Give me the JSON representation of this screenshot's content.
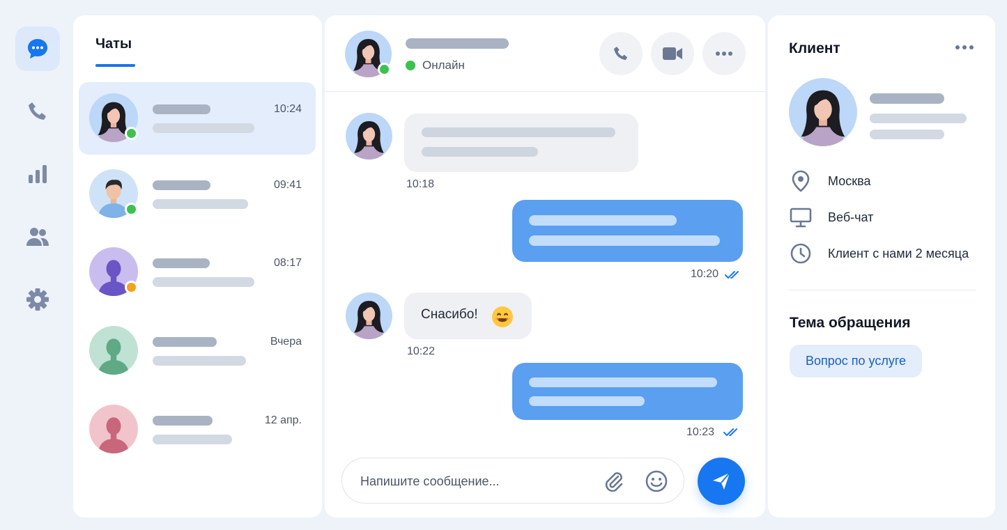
{
  "nav": {
    "items": [
      {
        "icon": "chat-bubble-icon",
        "active": true
      },
      {
        "icon": "phone-icon",
        "active": false
      },
      {
        "icon": "bar-chart-icon",
        "active": false
      },
      {
        "icon": "users-icon",
        "active": false
      },
      {
        "icon": "gear-icon",
        "active": false
      }
    ]
  },
  "chats": {
    "title": "Чаты",
    "items": [
      {
        "time": "10:24",
        "status": "online",
        "active": true
      },
      {
        "time": "09:41",
        "status": "online",
        "active": false
      },
      {
        "time": "08:17",
        "status": "away",
        "active": false
      },
      {
        "time": "Вчера",
        "status": "none",
        "active": false
      },
      {
        "time": "12 апр.",
        "status": "none",
        "active": false
      }
    ]
  },
  "conversation": {
    "status_text": "Онлайн",
    "actions": [
      "phone-icon",
      "video-camera-icon",
      "more-horizontal-icon"
    ],
    "messages": [
      {
        "direction": "in",
        "time": "10:18"
      },
      {
        "direction": "out",
        "time": "10:20",
        "read": true
      },
      {
        "direction": "in",
        "text": "Снасибо!",
        "emoji": "smiling-face-emoji",
        "time": "10:22"
      },
      {
        "direction": "out",
        "time": "10:23",
        "read": true
      }
    ],
    "composer": {
      "placeholder": "Напишите сообщение..."
    }
  },
  "client": {
    "title": "Клиент",
    "info": [
      {
        "icon": "location-pin-icon",
        "text": "Москва"
      },
      {
        "icon": "monitor-icon",
        "text": "Веб-чат"
      },
      {
        "icon": "clock-icon",
        "text": "Клиент с нами 2 месяца"
      }
    ],
    "topic_title": "Тема обращения",
    "topic_value": "Вопрос по услуге"
  },
  "colors": {
    "accent": "#1677f0",
    "online": "#3cc24f",
    "away": "#f5a11a",
    "outgoing_bubble": "#5a9ff0",
    "incoming_bubble": "#eef0f4"
  }
}
